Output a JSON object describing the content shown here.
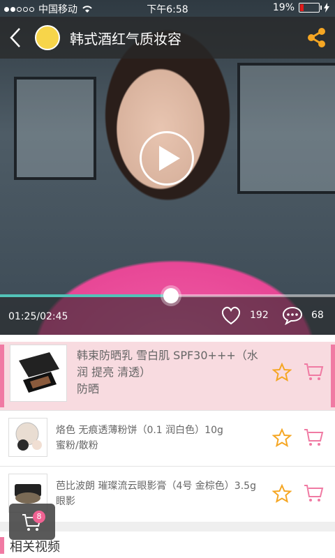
{
  "status": {
    "carrier": "中国移动",
    "time": "下午6:58",
    "battery": "19%",
    "battery_level": 0.19
  },
  "header": {
    "title": "韩式酒红气质妆容"
  },
  "player": {
    "time_display": "01:25/02:45",
    "progress": 0.51,
    "likes": "192",
    "comments": "68"
  },
  "products": [
    {
      "name": "韩束防晒乳 雪白肌 SPF30+++（水润 提亮 清透）",
      "category": "防晒"
    },
    {
      "name": "烙色 无痕透薄粉饼（0.1 润白色）10g",
      "category": "蜜粉/散粉"
    },
    {
      "name": "芭比波朗 璀璨流云眼影膏（4号 金棕色）3.5g",
      "category": "眼影"
    }
  ],
  "section": {
    "related_label": "相关视频"
  },
  "cart": {
    "count": "8"
  },
  "colors": {
    "accent": "#f07aa3",
    "progress": "#52c3b8",
    "featured_bg": "#f8dbe0",
    "star": "#f5a623"
  }
}
